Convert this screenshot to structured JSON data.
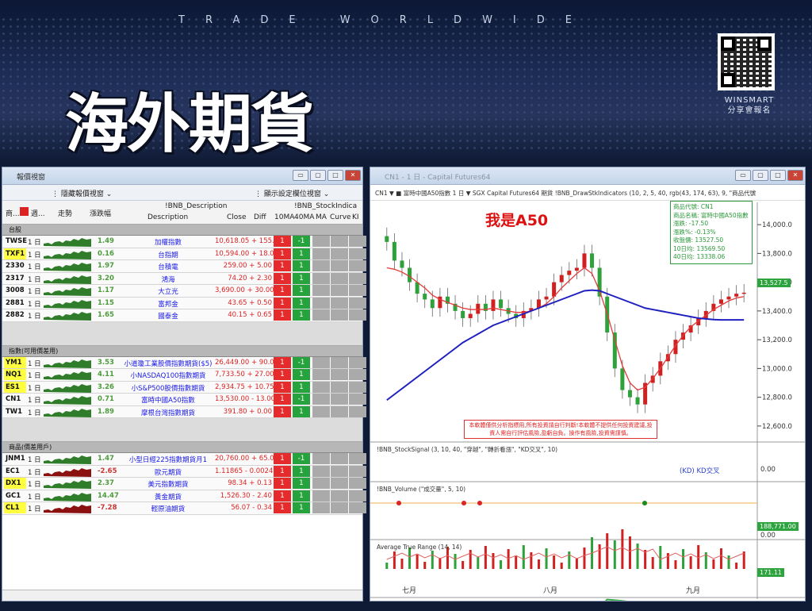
{
  "banner": {
    "tagline": "TRADE WORLDWIDE",
    "title": "海外期貨",
    "brand_line1": "WINSMART",
    "brand_line2": "分享會報名"
  },
  "left_window": {
    "title": "報價視窗",
    "toolbar_left": "隱藏報價視窗",
    "toolbar_right": "顯示設定欄位視窗",
    "headers": {
      "col0": "商...",
      "col1": "週...",
      "trend": "走勢",
      "pct": "漲跌幅",
      "desc_top": "!BNB_Description",
      "desc": "Description",
      "close": "Close",
      "diff": "Diff",
      "stock_top": "!BNB_StockIndica",
      "m10": "10MA",
      "m40": "40MA",
      "ma": "MA",
      "curve": "Curve",
      "k": "KI"
    },
    "sections": [
      {
        "name": "台股",
        "rows": [
          {
            "sym": "TWSE",
            "per": "1 日",
            "chg": "1.49",
            "desc": "加權指數",
            "close": "10,618.05",
            "diff": "+ 155.6",
            "m10": "1",
            "m40": "-1",
            "yl": false,
            "dn": false
          },
          {
            "sym": "TXF1",
            "per": "1 日",
            "chg": "0.16",
            "desc": "台指期",
            "close": "10,594.00",
            "diff": "+ 18.00",
            "m10": "1",
            "m40": "1",
            "yl": true,
            "dn": false
          },
          {
            "sym": "2330",
            "per": "1 日",
            "chg": "1.97",
            "desc": "台積電",
            "close": "259.00",
            "diff": "+ 5.00",
            "m10": "1",
            "m40": "1",
            "yl": false,
            "dn": false
          },
          {
            "sym": "2317",
            "per": "1 日",
            "chg": "3.20",
            "desc": "鴻海",
            "close": "74.20",
            "diff": "+ 2.30",
            "m10": "1",
            "m40": "1",
            "yl": false,
            "dn": false
          },
          {
            "sym": "3008",
            "per": "1 日",
            "chg": "1.17",
            "desc": "大立光",
            "close": "3,690.00",
            "diff": "+ 30.00",
            "m10": "1",
            "m40": "1",
            "yl": false,
            "dn": false
          },
          {
            "sym": "2881",
            "per": "1 日",
            "chg": "1.15",
            "desc": "富邦金",
            "close": "43.65",
            "diff": "+ 0.50",
            "m10": "1",
            "m40": "1",
            "yl": false,
            "dn": false
          },
          {
            "sym": "2882",
            "per": "1 日",
            "chg": "1.65",
            "desc": "國泰金",
            "close": "40.15",
            "diff": "+ 0.65",
            "m10": "1",
            "m40": "1",
            "yl": false,
            "dn": false
          }
        ]
      },
      {
        "name": "指數(可用價差用)",
        "rows": [
          {
            "sym": "YM1",
            "per": "1 日",
            "chg": "3.53",
            "desc": "小道瓊工業股價指數期貨($5)",
            "close": "26,449.00",
            "diff": "+ 90.00",
            "m10": "1",
            "m40": "-1",
            "yl": true,
            "dn": false
          },
          {
            "sym": "NQ1",
            "per": "1 日",
            "chg": "4.11",
            "desc": "小NASDAQ100指數期貨",
            "close": "7,733.50",
            "diff": "+ 27.00",
            "m10": "1",
            "m40": "1",
            "yl": true,
            "dn": false
          },
          {
            "sym": "ES1",
            "per": "1 日",
            "chg": "3.26",
            "desc": "小S&P500股價指數期貨",
            "close": "2,934.75",
            "diff": "+ 10.75",
            "m10": "1",
            "m40": "1",
            "yl": true,
            "dn": false
          },
          {
            "sym": "CN1",
            "per": "1 日",
            "chg": "0.71",
            "desc": "富時中國A50指數",
            "close": "13,530.00",
            "diff": "- 13.00",
            "m10": "1",
            "m40": "-1",
            "yl": false,
            "dn": false
          },
          {
            "sym": "TW1",
            "per": "1 日",
            "chg": "1.89",
            "desc": "摩根台灣指數期貨",
            "close": "391.80",
            "diff": "+ 0.00",
            "m10": "1",
            "m40": "1",
            "yl": false,
            "dn": false
          }
        ]
      },
      {
        "name": "商品(價差用戶)",
        "rows": [
          {
            "sym": "JNM1",
            "per": "1 日",
            "chg": "1.47",
            "desc": "小型日經225指數期貨月1",
            "close": "20,760.00",
            "diff": "+ 65.00",
            "m10": "1",
            "m40": "-1",
            "yl": false,
            "dn": false
          },
          {
            "sym": "EC1",
            "per": "1 日",
            "chg": "-2.65",
            "desc": "歐元期貨",
            "close": "1.11865",
            "diff": "- 0.0024",
            "m10": "1",
            "m40": "1",
            "yl": false,
            "dn": true
          },
          {
            "sym": "DX1",
            "per": "1 日",
            "chg": "2.37",
            "desc": "美元指數期貨",
            "close": "98.34",
            "diff": "+ 0.13",
            "m10": "1",
            "m40": "1",
            "yl": true,
            "dn": false
          },
          {
            "sym": "GC1",
            "per": "1 日",
            "chg": "14.47",
            "desc": "黃金期貨",
            "close": "1,526.30",
            "diff": "- 2.40",
            "m10": "1",
            "m40": "1",
            "yl": false,
            "dn": false
          },
          {
            "sym": "CL1",
            "per": "1 日",
            "chg": "-7.28",
            "desc": "輕原油期貨",
            "close": "56.07",
            "diff": "- 0.34",
            "m10": "1",
            "m40": "1",
            "yl": true,
            "dn": true
          }
        ]
      }
    ]
  },
  "right_window": {
    "title": "CN1 - 1 日 - Capital Futures64",
    "toolbar": "CN1 ▼ ■ 富時中國A50指數 1 日 ▼ SGX Capital Futures64 期貨 !BNB_DrawStkIndicators (10, 2, 5, 40, rgb(43, 174, 63), 9, \"商品代號",
    "annotation": "我是A50",
    "info_lines": [
      "商品代號: CN1",
      "商品名稱: 富時中國A50指數",
      "漲跌: -17.50",
      "漲跌%: -0.13%",
      "收盤價: 13527.50",
      "10日均: 13569.50",
      "40日均: 13338.06"
    ],
    "note": "本軟體僅供分析指標用,所有投資請自行判斷!本軟體不提供任何投資建議,投資人需自行評估風險,盈虧自負。操作有風險,投資需謹慎。",
    "price_ticks": [
      "14,000.0",
      "13,800.0",
      "13,600.0",
      "13,400.0",
      "13,200.0",
      "13,000.0",
      "12,800.0",
      "12,600.0"
    ],
    "price_tag": "13,527.5",
    "panel2_label": "!BNB_StockSignal  (3, 10, 40, \"穿越\", \"轉折看漲\", \"KD交叉\", 10)",
    "panel2_legend": "(KD) KD交叉",
    "panel2_tick": "0.00",
    "panel3_label": "!BNB_Volume  (\"成交量\", 5, 10)",
    "panel3_tag": "188,771.00",
    "panel3_tick": "0.00",
    "panel4_label": "Average True Range  (14, 14)",
    "panel4_tag": "171.11",
    "months": [
      "七月",
      "八月",
      "九月"
    ]
  },
  "chart_data": {
    "type": "candlestick",
    "title": "",
    "ylim": [
      12500,
      14100
    ],
    "series": [
      {
        "name": "close",
        "values": [
          13880,
          13750,
          13700,
          13600,
          13520,
          13480,
          13420,
          13500,
          13450,
          13400,
          13350,
          13380,
          13450,
          13400,
          13480,
          13420,
          13380,
          13350,
          13400,
          13420,
          13480,
          13500,
          13600,
          13650,
          13680,
          13700,
          13800,
          13700,
          13500,
          13250,
          13000,
          12850,
          12800,
          12750,
          12900,
          12950,
          13050,
          13100,
          13200,
          13250,
          13300,
          13350,
          13400,
          13450,
          13480,
          13500,
          13520,
          13527
        ]
      },
      {
        "name": "10MA",
        "values": [
          13700,
          13690,
          13670,
          13640,
          13600,
          13560,
          13510,
          13480,
          13460,
          13440,
          13420,
          13410,
          13410,
          13410,
          13420,
          13410,
          13400,
          13390,
          13390,
          13400,
          13420,
          13450,
          13500,
          13560,
          13610,
          13660,
          13700,
          13660,
          13540,
          13380,
          13200,
          13020,
          12900,
          12850,
          12870,
          12930,
          13000,
          13080,
          13160,
          13230,
          13290,
          13330,
          13370,
          13410,
          13440,
          13470,
          13490,
          13500
        ]
      },
      {
        "name": "40MA",
        "values": [
          12780,
          12820,
          12860,
          12900,
          12940,
          12980,
          13020,
          13060,
          13100,
          13140,
          13180,
          13210,
          13240,
          13270,
          13300,
          13320,
          13340,
          13360,
          13380,
          13400,
          13420,
          13440,
          13460,
          13480,
          13500,
          13520,
          13540,
          13545,
          13540,
          13520,
          13500,
          13480,
          13460,
          13440,
          13420,
          13410,
          13400,
          13390,
          13380,
          13370,
          13360,
          13350,
          13345,
          13340,
          13338,
          13338,
          13338,
          13338
        ]
      }
    ]
  }
}
